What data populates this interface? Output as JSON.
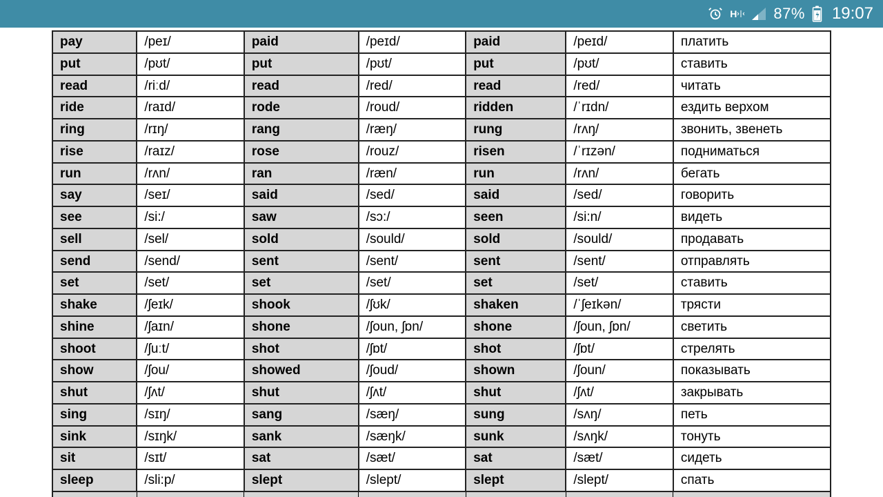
{
  "status": {
    "battery_text": "87%",
    "time": "19:07",
    "h_label": "H"
  },
  "verbs": [
    {
      "base": "pay",
      "ipa1": "/peɪ/",
      "past": "paid",
      "ipa2": "/peɪd/",
      "pp": "paid",
      "ipa3": "/peɪd/",
      "ru": "платить"
    },
    {
      "base": "put",
      "ipa1": "/pʊt/",
      "past": "put",
      "ipa2": "/pʊt/",
      "pp": "put",
      "ipa3": "/pʊt/",
      "ru": "ставить"
    },
    {
      "base": "read",
      "ipa1": "/riːd/",
      "past": "read",
      "ipa2": "/red/",
      "pp": "read",
      "ipa3": "/red/",
      "ru": "читать"
    },
    {
      "base": "ride",
      "ipa1": "/raɪd/",
      "past": "rode",
      "ipa2": "/roud/",
      "pp": "ridden",
      "ipa3": "/ˈrɪdn/",
      "ru": "ездить верхом"
    },
    {
      "base": "ring",
      "ipa1": "/rɪŋ/",
      "past": "rang",
      "ipa2": "/ræŋ/",
      "pp": "rung",
      "ipa3": "/rʌŋ/",
      "ru": "звонить, звенеть"
    },
    {
      "base": "rise",
      "ipa1": "/raɪz/",
      "past": "rose",
      "ipa2": "/rouz/",
      "pp": "risen",
      "ipa3": "/ˈrɪzən/",
      "ru": "подниматься"
    },
    {
      "base": "run",
      "ipa1": "/rʌn/",
      "past": "ran",
      "ipa2": "/ræn/",
      "pp": "run",
      "ipa3": "/rʌn/",
      "ru": "бегать"
    },
    {
      "base": "say",
      "ipa1": "/seɪ/",
      "past": "said",
      "ipa2": "/sed/",
      "pp": "said",
      "ipa3": "/sed/",
      "ru": "говорить"
    },
    {
      "base": "see",
      "ipa1": "/si:/",
      "past": "saw",
      "ipa2": "/sɔ:/",
      "pp": "seen",
      "ipa3": "/si:n/",
      "ru": "видеть"
    },
    {
      "base": "sell",
      "ipa1": "/sel/",
      "past": "sold",
      "ipa2": "/sould/",
      "pp": "sold",
      "ipa3": "/sould/",
      "ru": "продавать"
    },
    {
      "base": "send",
      "ipa1": "/send/",
      "past": "sent",
      "ipa2": "/sent/",
      "pp": "sent",
      "ipa3": "/sent/",
      "ru": "отправлять"
    },
    {
      "base": "set",
      "ipa1": "/set/",
      "past": "set",
      "ipa2": "/set/",
      "pp": "set",
      "ipa3": "/set/",
      "ru": "ставить"
    },
    {
      "base": "shake",
      "ipa1": "/ʃeɪk/",
      "past": "shook",
      "ipa2": "/ʃʊk/",
      "pp": "shaken",
      "ipa3": "/ˈʃeɪkən/",
      "ru": "трясти"
    },
    {
      "base": "shine",
      "ipa1": "/ʃaɪn/",
      "past": "shone",
      "ipa2": "/ʃoun, ʃɒn/",
      "pp": "shone",
      "ipa3": "/ʃoun, ʃɒn/",
      "ru": "светить"
    },
    {
      "base": "shoot",
      "ipa1": "/ʃuːt/",
      "past": "shot",
      "ipa2": "/ʃɒt/",
      "pp": "shot",
      "ipa3": "/ʃɒt/",
      "ru": "стрелять"
    },
    {
      "base": "show",
      "ipa1": "/ʃou/",
      "past": "showed",
      "ipa2": "/ʃoud/",
      "pp": "shown",
      "ipa3": "/ʃoun/",
      "ru": "показывать"
    },
    {
      "base": "shut",
      "ipa1": "/ʃʌt/",
      "past": "shut",
      "ipa2": "/ʃʌt/",
      "pp": "shut",
      "ipa3": "/ʃʌt/",
      "ru": "закрывать"
    },
    {
      "base": "sing",
      "ipa1": "/sɪŋ/",
      "past": "sang",
      "ipa2": "/sæŋ/",
      "pp": "sung",
      "ipa3": "/sʌŋ/",
      "ru": "петь"
    },
    {
      "base": "sink",
      "ipa1": "/sɪŋk/",
      "past": "sank",
      "ipa2": "/sæŋk/",
      "pp": "sunk",
      "ipa3": "/sʌŋk/",
      "ru": "тонуть"
    },
    {
      "base": "sit",
      "ipa1": "/sɪt/",
      "past": "sat",
      "ipa2": "/sæt/",
      "pp": "sat",
      "ipa3": "/sæt/",
      "ru": "сидеть"
    },
    {
      "base": "sleep",
      "ipa1": "/sli:p/",
      "past": "slept",
      "ipa2": "/slept/",
      "pp": "slept",
      "ipa3": "/slept/",
      "ru": "спать"
    }
  ]
}
